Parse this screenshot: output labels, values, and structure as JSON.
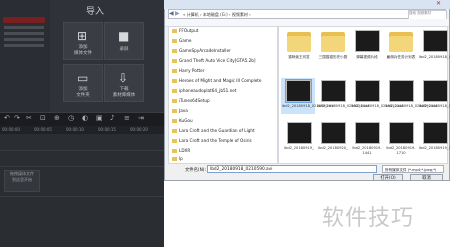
{
  "editor": {
    "import_title": "导入",
    "tiles": [
      {
        "icon": "import-media-icon",
        "label": "添加\n媒体文件"
      },
      {
        "icon": "record-icon",
        "label": "录屏"
      },
      {
        "icon": "add-folder-icon",
        "label": "添加\n文件夹"
      },
      {
        "icon": "download-media-icon",
        "label": "下载\n素材库媒体"
      }
    ],
    "ruler_times": [
      "00:00:00",
      "00:00:05",
      "00:00:10",
      "00:00:15",
      "00:00:20"
    ],
    "timeline_drop_text": "拖拽媒体文件\n到这里开始"
  },
  "dialog": {
    "address_path": "« 计算机 › 本地磁盘 (G:) › 视频素材 ›",
    "search_placeholder": "搜索 视频素材",
    "tree_items": [
      "FFOutput",
      "Game",
      "GameSpyArcadeInstaller",
      "Grand Theft Auto Vice City[GTA5.2b]",
      "Harry Potter",
      "Heroes of Might and Magic III Complete",
      "iphoneaudoplat64_jb51.net",
      "iTunes64Setup",
      "Java",
      "KuGou",
      "Lara Croft and the Guardian of Light",
      "Lara Croft and the Temple of Osiris",
      "LDXR",
      "lp"
    ],
    "files": [
      {
        "name": "猫咪偷王问答",
        "type": "folder"
      },
      {
        "name": "三国猫猫历史小剧",
        "type": "folder"
      },
      {
        "name": "弹幕视频片段",
        "type": "video"
      },
      {
        "name": "雇佣兵任务计划表",
        "type": "folder"
      },
      {
        "name": "lbd2_20180918_02",
        "type": "video"
      },
      {
        "name": "lbd2_20180918_0210590.avi",
        "type": "video",
        "selected": true
      },
      {
        "name": "lbd2_20180918_0215226.avi",
        "type": "video"
      },
      {
        "name": "lbd2_20180918_0215410.avi",
        "type": "video"
      },
      {
        "name": "lbd2_20180918_0240590.avi",
        "type": "video"
      },
      {
        "name": "lbd2_20180918_0251011.avi",
        "type": "video"
      },
      {
        "name": "lbd2_20180919_",
        "type": "video"
      },
      {
        "name": "lbd2_20180920_",
        "type": "video"
      },
      {
        "name": "lbd2_20180919-1441",
        "type": "video"
      },
      {
        "name": "lbd2_20180919-1710",
        "type": "video"
      },
      {
        "name": "lbd2_20180919_1918",
        "type": "video"
      }
    ],
    "filename_label": "文件名(N):",
    "filename_value": "lbd2_20180918_0210590.avi",
    "filter_value": "所有媒体文件 (*.mp4;*.jpeg;*)",
    "open_label": "打开(O)",
    "cancel_label": "取消"
  },
  "watermark": "软件技巧"
}
